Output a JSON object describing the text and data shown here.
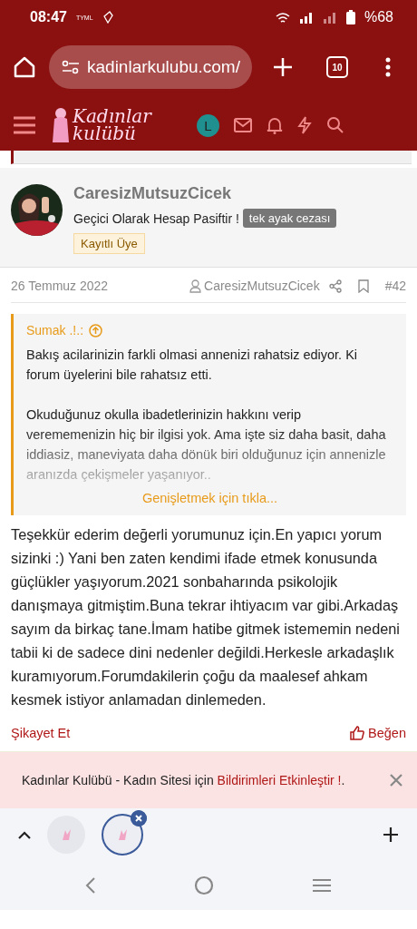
{
  "status_bar": {
    "time": "08:47",
    "carrier": "TYML",
    "battery": "%68"
  },
  "browser": {
    "url": "kadinlarkulubu.com/",
    "tab_count": "10"
  },
  "site_header": {
    "logo_lines": [
      "Kadınlar",
      "kulübü"
    ],
    "avatar_letter": "L"
  },
  "post": {
    "author": "CaresizMutsuzCicek",
    "status": "Geçici Olarak Hesap Pasiftir !",
    "banner": "tek ayak cezası",
    "user_title": "Kayıtlı Üye",
    "date": "26 Temmuz 2022",
    "meta_author": "CaresizMutsuzCicek",
    "number": "#42",
    "quote": {
      "author": "Sumak .!.:",
      "paragraphs": [
        "Bakış acilarinizin farkli olmasi annenizi rahatsiz ediyor. Ki forum üyelerini bile rahatsız etti.",
        "Okuduğunuz okulla ibadetlerinizin hakkını verip verememenizin hiç bir ilgisi yok. Ama işte siz daha basit, daha iddiasiz, maneviyata daha dönük biri olduğunuz için annenizle aranızda çekişmeler yaşanıyor.."
      ],
      "expand": "Genişletmek için tıkla..."
    },
    "body": "Teşekkür ederim değerli yorumunuz için.En yapıcı yorum sizinki :) Yani ben zaten kendimi ifade etmek konusunda güçlükler yaşıyorum.2021 sonbaharında psikolojik danışmaya gitmiştim.Buna tekrar ihtiyacım var gibi.Arkadaş sayım da birkaç tane.İmam hatibe gitmek istememin nedeni tabii ki de sadece dini nedenler değildi.Herkesle arkadaşlık kuramıyorum.Forumdakilerin çoğu da maalesef ahkam kesmek istiyor anlamadan dinlemeden.",
    "report": "Şikayet Et",
    "like": "Beğen"
  },
  "notice": {
    "text": "Kadınlar Kulübü - Kadın Sitesi için ",
    "link": "Bildirimleri Etkinleştir !",
    "suffix": "."
  },
  "tab_strip": {
    "tabs": [
      {
        "selected": false
      },
      {
        "selected": true
      }
    ]
  }
}
